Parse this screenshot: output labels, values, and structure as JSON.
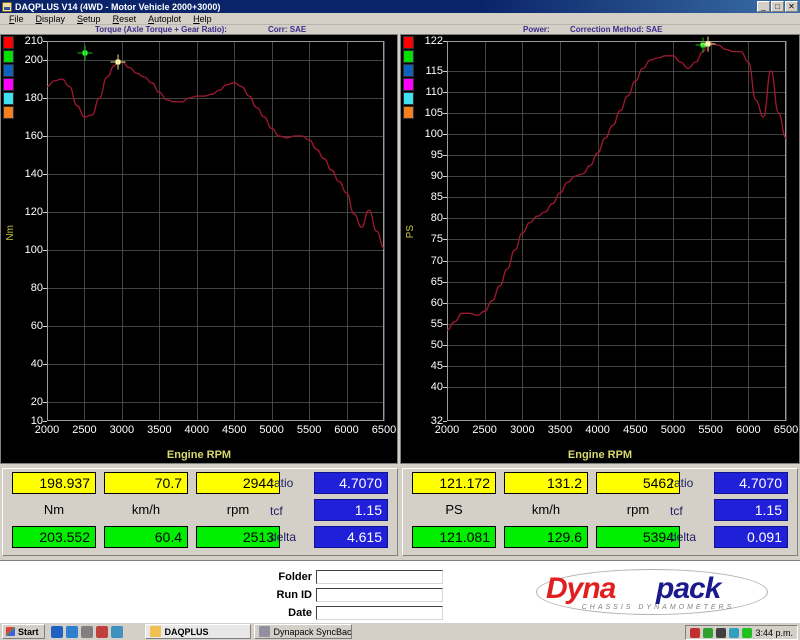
{
  "window": {
    "title": "DAQPLUS V14 (4WD - Motor Vehicle 2000+3000)",
    "icon": "app-icon",
    "minimize": "_",
    "maximize": "□",
    "close": "✕"
  },
  "menu": {
    "items": [
      "File",
      "Display",
      "Setup",
      "Reset",
      "Autoplot",
      "Help"
    ]
  },
  "charts": {
    "left": {
      "header_title": "Torque (Axle Torque + Gear Ratio):",
      "header_corr": "Corr: SAE",
      "ylabel": "Nm",
      "xlabel": "Engine RPM"
    },
    "right": {
      "header_title": "Power:",
      "header_corr": "Correction Method: SAE",
      "ylabel": "PS",
      "xlabel": "Engine RPM"
    },
    "swatch_colors": [
      "#ff0000",
      "#00e000",
      "#1060c0",
      "#ff00ff",
      "#40e0f0",
      "#f08020"
    ]
  },
  "chart_data": [
    {
      "type": "line",
      "title": "Torque (Axle Torque + Gear Ratio):",
      "xlabel": "Engine RPM",
      "ylabel": "Nm",
      "xlim": [
        2000,
        6500
      ],
      "ylim": [
        10,
        210
      ],
      "xticks": [
        2000,
        2500,
        3000,
        3500,
        4000,
        4500,
        5000,
        5500,
        6000,
        6500
      ],
      "yticks": [
        10,
        20,
        40,
        60,
        80,
        100,
        120,
        140,
        160,
        180,
        200,
        210
      ],
      "grid": true,
      "legend": "none",
      "line_color": "#a01830",
      "series": [
        {
          "name": "Torque",
          "x": [
            2000,
            2100,
            2200,
            2300,
            2400,
            2500,
            2600,
            2700,
            2800,
            2900,
            2944,
            3000,
            3100,
            3200,
            3300,
            3400,
            3500,
            3600,
            3700,
            3800,
            3900,
            4000,
            4100,
            4200,
            4300,
            4400,
            4500,
            4600,
            4700,
            4800,
            4900,
            5000,
            5100,
            5200,
            5300,
            5400,
            5500,
            5600,
            5700,
            5800,
            5900,
            6000,
            6100,
            6200,
            6300,
            6400,
            6500
          ],
          "y": [
            186,
            189,
            190,
            186,
            176,
            170,
            171,
            180,
            191,
            197,
            198.9,
            199,
            196,
            193,
            191,
            188,
            183,
            179,
            178,
            178,
            180,
            181,
            181,
            182,
            184,
            187,
            188,
            186,
            181,
            175,
            170,
            164,
            160,
            159,
            160,
            160,
            158,
            153,
            148,
            142,
            136,
            130,
            119,
            112,
            121,
            110,
            101
          ]
        }
      ],
      "markers": [
        {
          "name": "green-marker",
          "x": 2513,
          "y": 203.552,
          "color": "#30ff30"
        },
        {
          "name": "yellow-marker",
          "x": 2944,
          "y": 198.937,
          "color": "#fffbc0"
        }
      ]
    },
    {
      "type": "line",
      "title": "Power:",
      "xlabel": "Engine RPM",
      "ylabel": "PS",
      "xlim": [
        2000,
        6500
      ],
      "ylim": [
        32,
        122
      ],
      "xticks": [
        2000,
        2500,
        3000,
        3500,
        4000,
        4500,
        5000,
        5500,
        6000,
        6500
      ],
      "yticks": [
        32,
        40,
        45,
        50,
        55,
        60,
        65,
        70,
        75,
        80,
        85,
        90,
        95,
        100,
        105,
        110,
        115,
        122
      ],
      "grid": true,
      "legend": "none",
      "line_color": "#a01830",
      "series": [
        {
          "name": "Power",
          "x": [
            2000,
            2100,
            2200,
            2300,
            2400,
            2500,
            2600,
            2700,
            2800,
            2900,
            3000,
            3100,
            3200,
            3300,
            3400,
            3500,
            3600,
            3700,
            3800,
            3900,
            4000,
            4100,
            4200,
            4300,
            4400,
            4500,
            4600,
            4700,
            4800,
            4900,
            5000,
            5100,
            5200,
            5300,
            5400,
            5462,
            5500,
            5600,
            5700,
            5800,
            5900,
            6000,
            6100,
            6200,
            6300,
            6400,
            6500
          ],
          "y": [
            53.5,
            55.5,
            57.5,
            57.5,
            57,
            58,
            60.5,
            64,
            68,
            72.5,
            76.5,
            79,
            80.5,
            81.5,
            83.5,
            86,
            88.5,
            90,
            90.5,
            92.5,
            95.5,
            99,
            102,
            105.5,
            109,
            112.5,
            115.5,
            117.5,
            118,
            118.5,
            118.5,
            117,
            115.5,
            117,
            119.5,
            121.2,
            121.5,
            121,
            120,
            119.5,
            119.5,
            117,
            108,
            104,
            115,
            105,
            99
          ]
        }
      ],
      "markers": [
        {
          "name": "green-marker",
          "x": 5394,
          "y": 121.081,
          "color": "#30ff30"
        },
        {
          "name": "yellow-marker",
          "x": 5462,
          "y": 121.172,
          "color": "#fffbc0"
        }
      ]
    }
  ],
  "readouts": {
    "left": {
      "yellow": [
        "198.937",
        "70.7",
        "2944"
      ],
      "units": [
        "Nm",
        "km/h",
        "rpm"
      ],
      "green": [
        "203.552",
        "60.4",
        "2513"
      ],
      "blue_labels": [
        "ratio",
        "tcf",
        "delta"
      ],
      "blue_values": [
        "4.7070",
        "1.15",
        "4.615"
      ]
    },
    "right": {
      "yellow": [
        "121.172",
        "131.2",
        "5462"
      ],
      "units": [
        "PS",
        "km/h",
        "rpm"
      ],
      "green": [
        "121.081",
        "129.6",
        "5394"
      ],
      "blue_labels": [
        "ratio",
        "tcf",
        "delta"
      ],
      "blue_values": [
        "4.7070",
        "1.15",
        "0.091"
      ]
    }
  },
  "form": {
    "fields": [
      {
        "label": "Folder",
        "value": ""
      },
      {
        "label": "Run ID",
        "value": ""
      },
      {
        "label": "Date",
        "value": ""
      }
    ]
  },
  "logo": {
    "part1": "Dyna",
    "part2": "pack",
    "tagline": "CHASSIS DYNAMOMETERS"
  },
  "taskbar": {
    "start_label": "Start",
    "quicklaunch": [
      "ie-icon",
      "outlook-icon",
      "desktop-icon",
      "media-icon",
      "explorer-icon"
    ],
    "tasks": [
      {
        "label": "DAQPLUS",
        "icon": "daqplus-icon",
        "active": true
      },
      {
        "label": "Dynapack SyncBackSE V...",
        "icon": "syncback-icon",
        "active": false
      }
    ],
    "tray_icons": [
      "network-icon",
      "volume-icon",
      "security-icon",
      "update-icon",
      "battery-icon"
    ],
    "clock": "3:44 p.m."
  }
}
